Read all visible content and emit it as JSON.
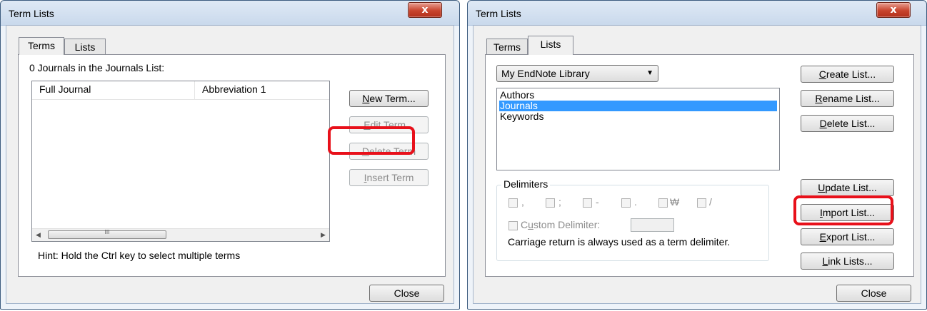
{
  "left_dialog": {
    "title": "Term Lists",
    "close_x": "x",
    "tabs": [
      "Terms",
      "Lists"
    ],
    "count_text": "0 Journals in the Journals List:",
    "columns": [
      "Full Journal",
      "Abbreviation 1"
    ],
    "scroll_glyph": "III",
    "buttons": {
      "new_term": {
        "prefix": "",
        "accel": "N",
        "rest": "ew Term..."
      },
      "edit_term": {
        "prefix": "",
        "accel": "E",
        "rest": "dit Term..."
      },
      "delete_term": {
        "prefix": "",
        "accel": "D",
        "rest": "elete Term"
      },
      "insert_term": {
        "prefix": "",
        "accel": "I",
        "rest": "nsert Term"
      }
    },
    "hint": "Hint: Hold the Ctrl key to select multiple terms",
    "close_label": "Close"
  },
  "right_dialog": {
    "title": "Term Lists",
    "close_x": "x",
    "tabs": [
      "Terms",
      "Lists"
    ],
    "library_select": "My EndNote Library",
    "lists": [
      "Authors",
      "Journals",
      "Keywords"
    ],
    "selected_list": "Journals",
    "buttons": {
      "create_list": {
        "accel": "C",
        "rest": "reate List..."
      },
      "rename_list": {
        "accel": "R",
        "rest": "ename List..."
      },
      "delete_list": {
        "accel": "D",
        "rest": "elete List..."
      },
      "update_list": {
        "accel": "U",
        "rest": "pdate List..."
      },
      "import_list": {
        "accel": "I",
        "rest": "mport List..."
      },
      "export_list": {
        "accel": "E",
        "rest": "xport List..."
      },
      "link_lists": {
        "accel": "L",
        "rest": "ink Lists..."
      }
    },
    "delimiters_label": "Delimiters",
    "delimiter_options": [
      ",",
      ";",
      "-",
      ".",
      "₩",
      "/"
    ],
    "custom_delimiter": {
      "pre": "C",
      "accel": "u",
      "rest": "stom Delimiter:"
    },
    "carriage_note": "Carriage return is always used as a term delimiter.",
    "close_label": "Close"
  },
  "highlight_color": "#e8101a"
}
